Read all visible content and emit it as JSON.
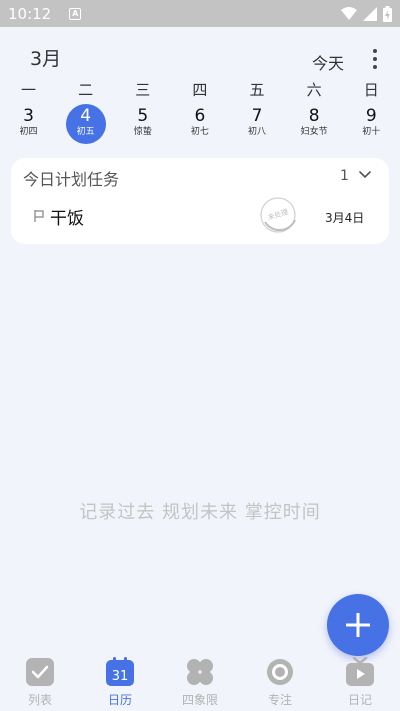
{
  "status_bar": {
    "time": "10:12",
    "a_icon": "A"
  },
  "header": {
    "month": "3月",
    "today_label": "今天"
  },
  "weekdays": [
    "一",
    "二",
    "三",
    "四",
    "五",
    "六",
    "日"
  ],
  "dates": [
    {
      "day": "3",
      "lunar": "初四"
    },
    {
      "day": "4",
      "lunar": "初五",
      "selected": true
    },
    {
      "day": "5",
      "lunar": "惊蛰"
    },
    {
      "day": "6",
      "lunar": "初七"
    },
    {
      "day": "7",
      "lunar": "初八"
    },
    {
      "day": "8",
      "lunar": "妇女节"
    },
    {
      "day": "9",
      "lunar": "初十"
    }
  ],
  "task_card": {
    "title": "今日计划任务",
    "count": "1",
    "tasks": [
      {
        "title": "干饭",
        "stamp_text": "未处理",
        "date": "3月4日"
      }
    ]
  },
  "empty_hint": "记录过去 规划未来 掌控时间",
  "tabbar": [
    {
      "label": "列表",
      "icon": "check-square-icon"
    },
    {
      "label": "日历",
      "icon": "calendar-icon",
      "icon_text": "31",
      "active": true
    },
    {
      "label": "四象限",
      "icon": "four-quadrant-icon"
    },
    {
      "label": "专注",
      "icon": "focus-target-icon"
    },
    {
      "label": "日记",
      "icon": "diary-tv-icon"
    }
  ],
  "colors": {
    "accent": "#4772e6",
    "background": "#f2f4fb",
    "inactive": "#b3b3b3",
    "status_bar": "#c3c3c3"
  }
}
